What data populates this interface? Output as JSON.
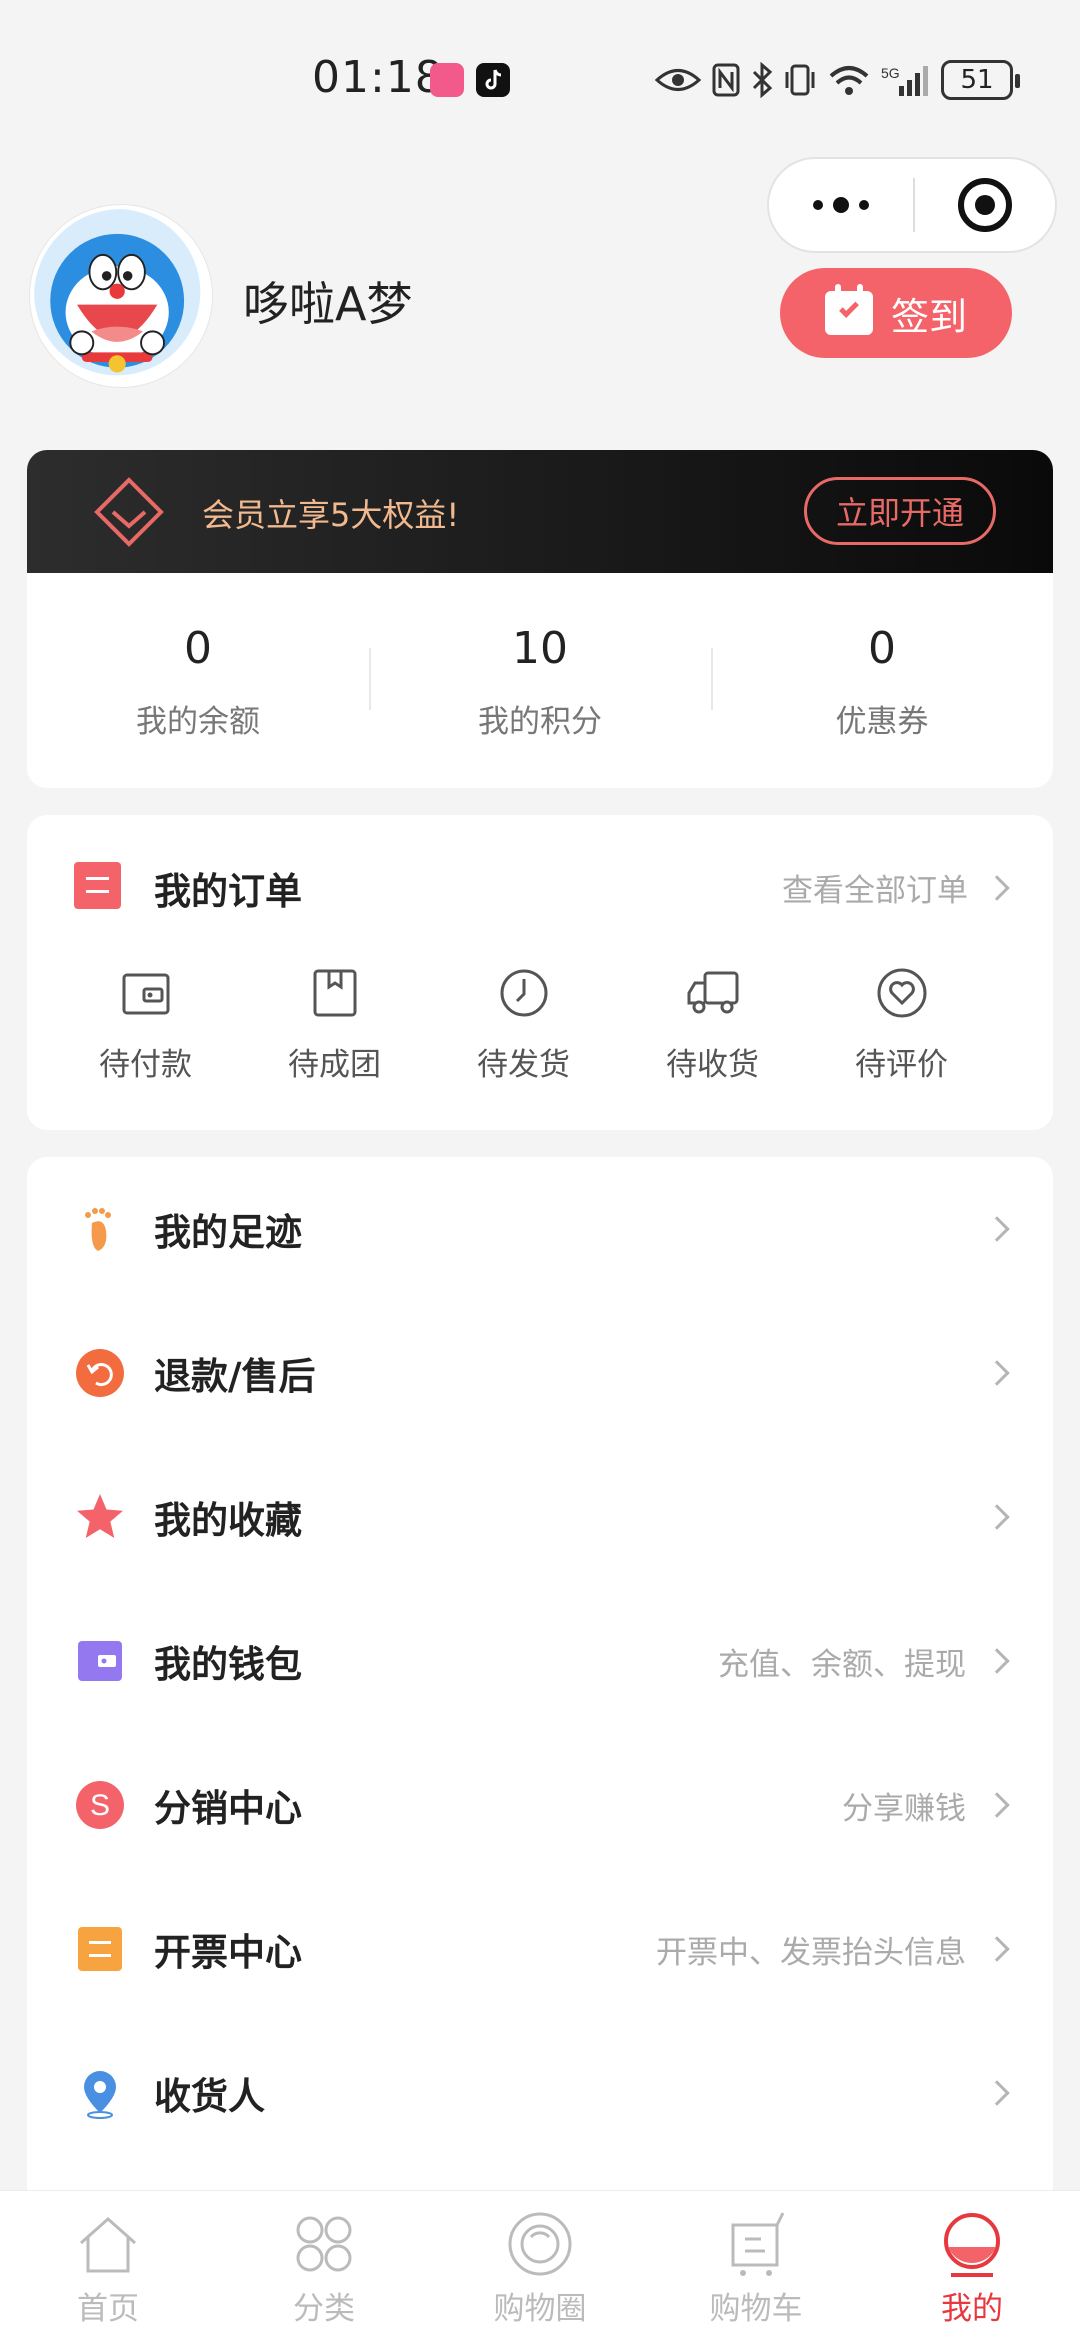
{
  "status_bar": {
    "time": "01:18",
    "battery": "51"
  },
  "profile": {
    "username": "哆啦A梦",
    "sign_in_label": "签到"
  },
  "member": {
    "banner_text": "会员立享5大权益!",
    "activate_label": "立即开通"
  },
  "stats": [
    {
      "value": "0",
      "label": "我的余额"
    },
    {
      "value": "10",
      "label": "我的积分"
    },
    {
      "value": "0",
      "label": "优惠券"
    }
  ],
  "orders": {
    "title": "我的订单",
    "view_all": "查看全部订单",
    "statuses": [
      {
        "label": "待付款",
        "icon": "wallet-icon"
      },
      {
        "label": "待成团",
        "icon": "box-icon"
      },
      {
        "label": "待发货",
        "icon": "clock-icon"
      },
      {
        "label": "待收货",
        "icon": "truck-icon"
      },
      {
        "label": "待评价",
        "icon": "heart-icon"
      }
    ]
  },
  "menu": [
    {
      "label": "我的足迹",
      "sub": "",
      "icon": "footprint-icon",
      "color": "#f49a4a"
    },
    {
      "label": "退款/售后",
      "sub": "",
      "icon": "refund-icon",
      "color": "#f26c3f"
    },
    {
      "label": "我的收藏",
      "sub": "",
      "icon": "star-icon",
      "color": "#f4636a"
    },
    {
      "label": "我的钱包",
      "sub": "充值、余额、提现",
      "icon": "wallet-icon",
      "color": "#9478f0"
    },
    {
      "label": "分销中心",
      "sub": "分享赚钱",
      "icon": "s-coin-icon",
      "color": "#f4636a"
    },
    {
      "label": "开票中心",
      "sub": "开票中、发票抬头信息",
      "icon": "invoice-icon",
      "color": "#f7a440"
    },
    {
      "label": "收货人",
      "sub": "",
      "icon": "location-pin-icon",
      "color": "#4a90e2"
    }
  ],
  "tabs": [
    {
      "label": "首页",
      "icon": "home-icon"
    },
    {
      "label": "分类",
      "icon": "category-icon"
    },
    {
      "label": "购物圈",
      "icon": "circle-icon"
    },
    {
      "label": "购物车",
      "icon": "cart-icon"
    },
    {
      "label": "我的",
      "icon": "profile-icon",
      "active": true
    }
  ],
  "colors": {
    "accent": "#f4636a",
    "active_tab": "#e7383f",
    "member_gold": "#f0b98f"
  }
}
